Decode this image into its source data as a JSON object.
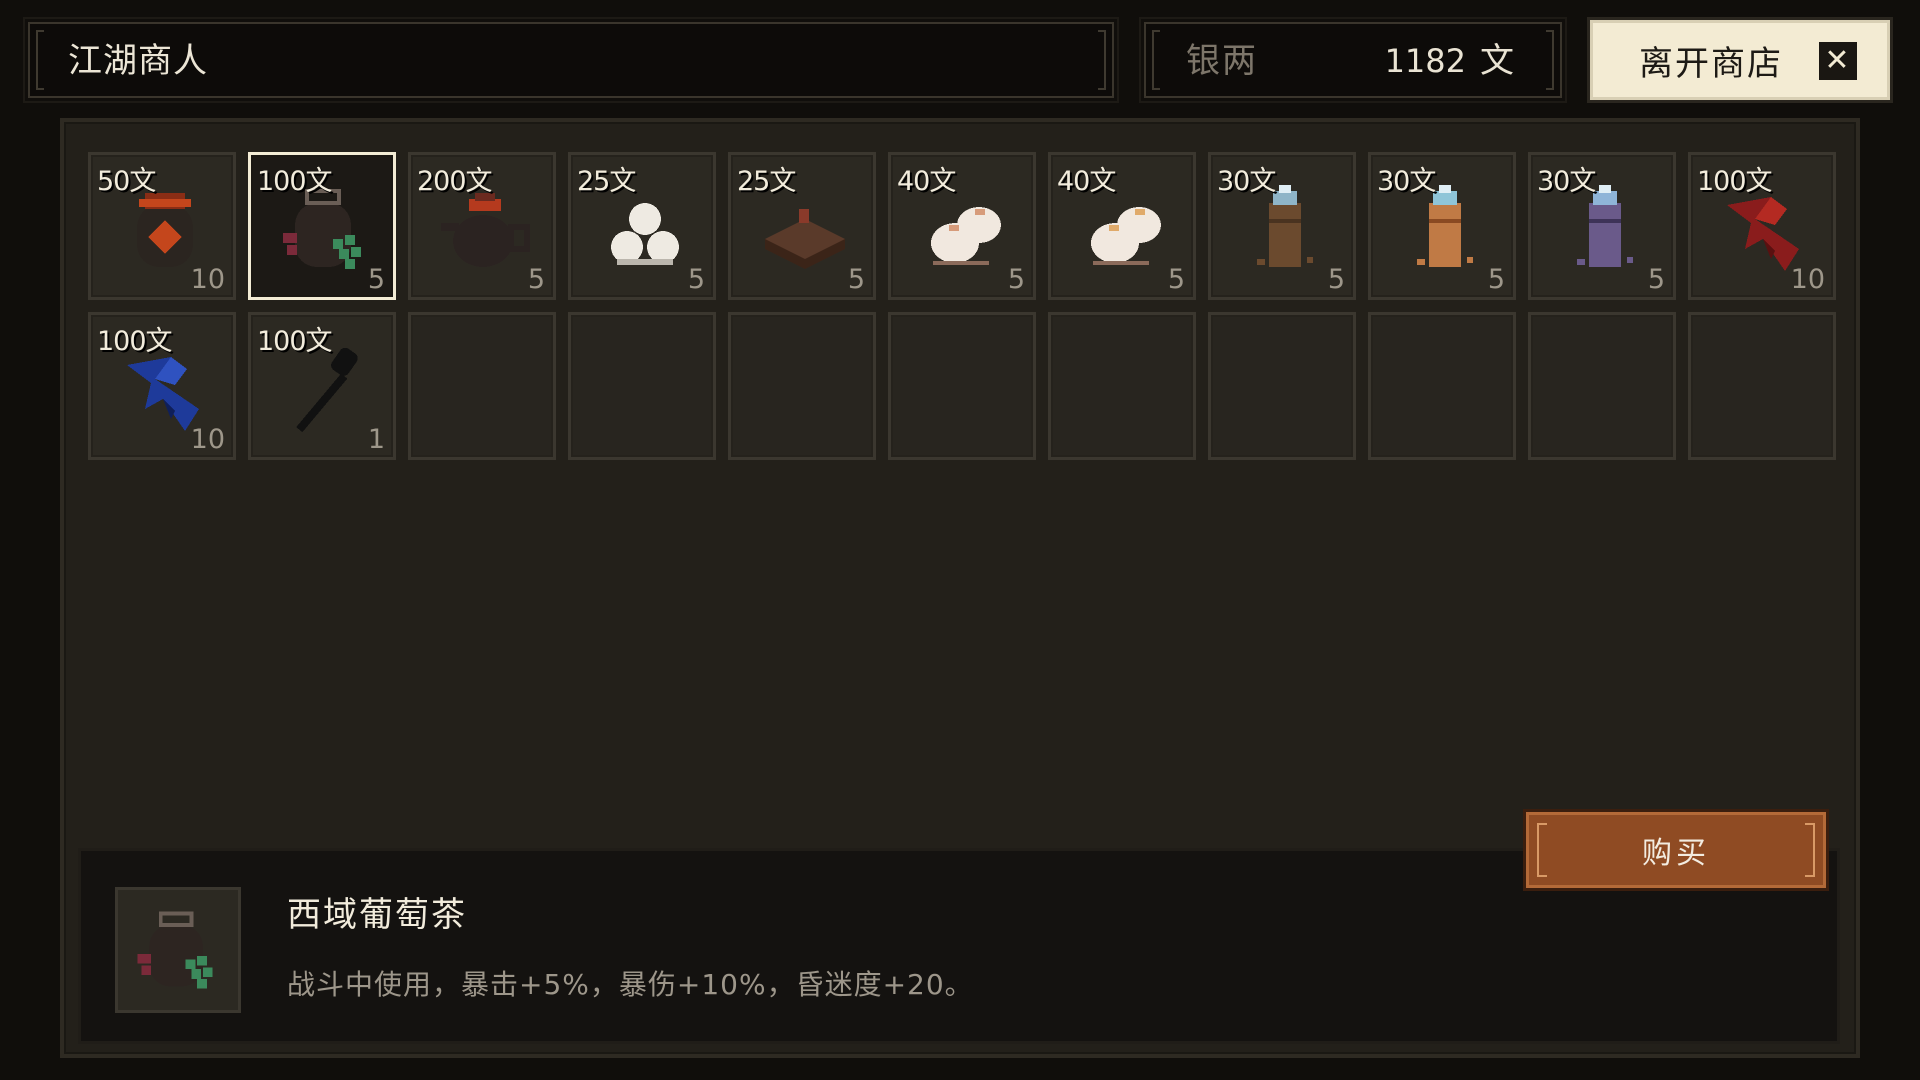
{
  "merchant": {
    "name": "江湖商人"
  },
  "money": {
    "label": "银两",
    "amount": "1182",
    "unit": "文"
  },
  "leave_button": {
    "label": "离开商店",
    "icon": "close-icon"
  },
  "items": [
    {
      "price": "50文",
      "qty": "10",
      "icon": "red-seal-jar-icon",
      "colors": [
        "#2b2520",
        "#c4461c",
        "#8a2d15"
      ]
    },
    {
      "price": "100文",
      "qty": "5",
      "icon": "grape-tea-jar-icon",
      "colors": [
        "#2d2521",
        "#3b8a5c",
        "#7b2a3a"
      ],
      "selected": true
    },
    {
      "price": "200文",
      "qty": "5",
      "icon": "teapot-icon",
      "colors": [
        "#2b2321",
        "#b53a1e",
        "#6b2a1f"
      ]
    },
    {
      "price": "25文",
      "qty": "5",
      "icon": "rice-balls-icon",
      "colors": [
        "#eeeae2",
        "#bbb6ad",
        "#888"
      ]
    },
    {
      "price": "25文",
      "qty": "5",
      "icon": "cake-icon",
      "colors": [
        "#5a3a2a",
        "#3b2418",
        "#8a3a2a"
      ]
    },
    {
      "price": "40文",
      "qty": "5",
      "icon": "steamed-bun-icon",
      "colors": [
        "#f1e8df",
        "#d79b7a",
        "#8b6a5a"
      ]
    },
    {
      "price": "40文",
      "qty": "5",
      "icon": "steamed-bun-icon",
      "colors": [
        "#f1e8df",
        "#e0aa6a",
        "#8b6a5a"
      ]
    },
    {
      "price": "30文",
      "qty": "5",
      "icon": "bamboo-tube-icon",
      "colors": [
        "#6b4a2e",
        "#8fb5c8",
        "#4a3320"
      ]
    },
    {
      "price": "30文",
      "qty": "5",
      "icon": "bamboo-tube-icon",
      "colors": [
        "#c07a45",
        "#8fc5d8",
        "#8a4a22"
      ]
    },
    {
      "price": "30文",
      "qty": "5",
      "icon": "bamboo-tube-icon",
      "colors": [
        "#6a5a8a",
        "#8fb5d8",
        "#3e3358"
      ]
    },
    {
      "price": "100文",
      "qty": "10",
      "icon": "red-cloak-icon",
      "colors": [
        "#8a1c1c",
        "#b42a22",
        "#5a1010"
      ]
    },
    {
      "price": "100文",
      "qty": "10",
      "icon": "blue-cloak-icon",
      "colors": [
        "#1e3a9a",
        "#2f52c0",
        "#0f1f5a"
      ]
    },
    {
      "price": "100文",
      "qty": "1",
      "icon": "black-staff-icon",
      "colors": [
        "#111",
        "#222",
        "#333"
      ]
    }
  ],
  "empty_slots": 9,
  "detail": {
    "title": "西域葡萄茶",
    "description": "战斗中使用，暴击+5%，暴伤+10%，昏迷度+20。",
    "icon": "grape-tea-jar-icon"
  },
  "buy_button": {
    "label": "购买"
  }
}
